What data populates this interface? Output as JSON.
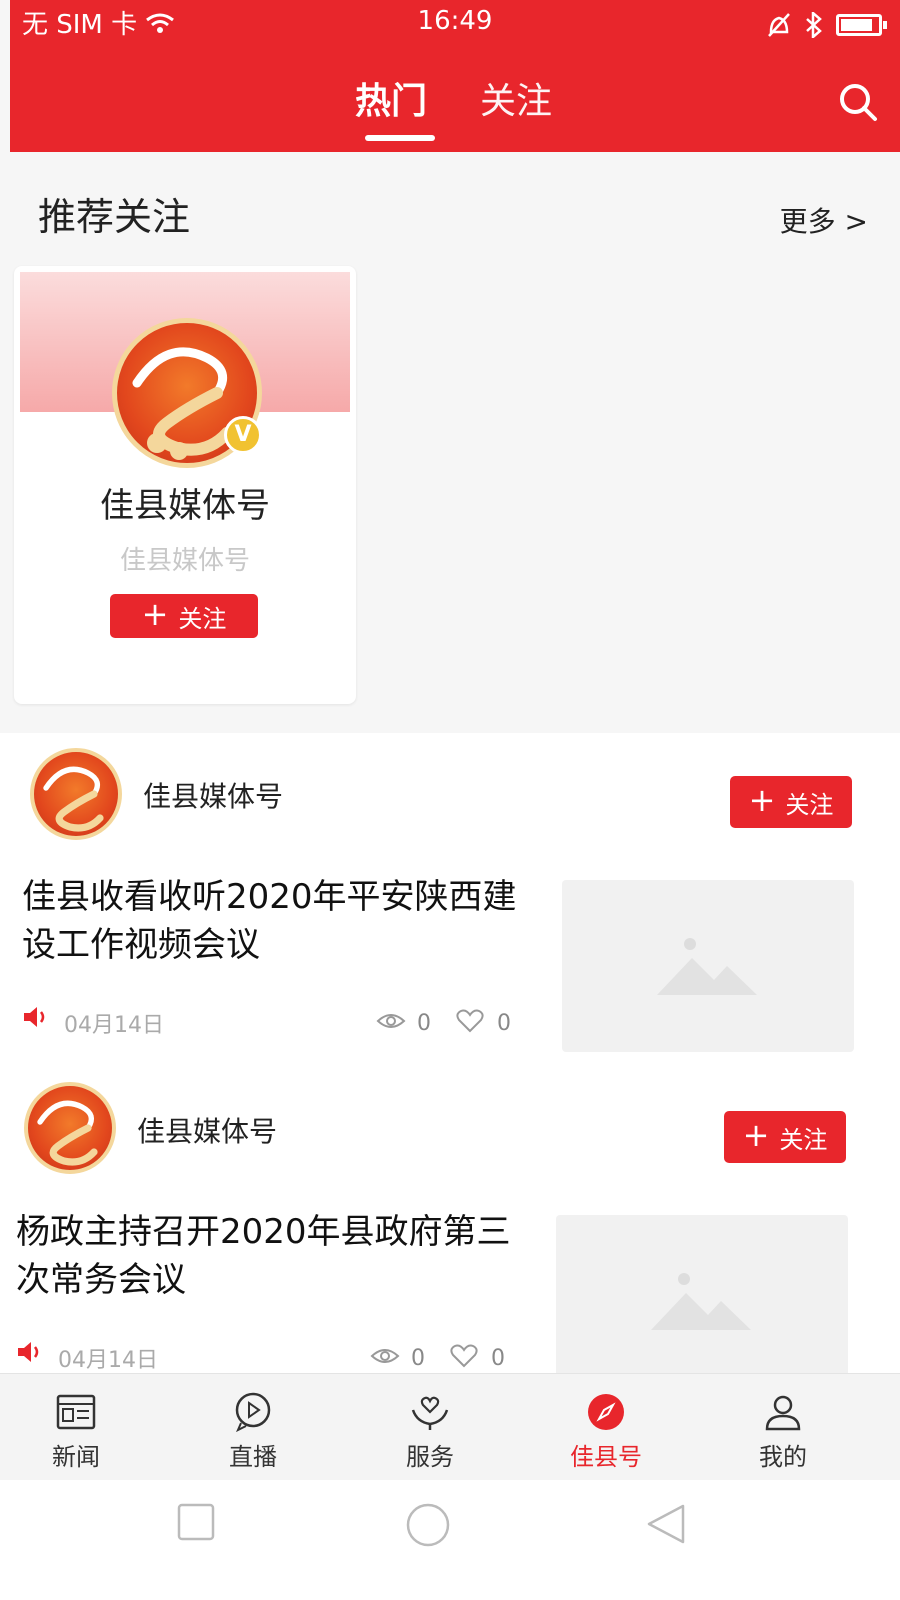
{
  "status_bar": {
    "carrier": "无 SIM 卡",
    "time": "16:49",
    "battery_level": 0.85
  },
  "header": {
    "tabs": [
      {
        "label": "热门",
        "active": true
      },
      {
        "label": "关注",
        "active": false
      }
    ],
    "search_icon": "search-icon",
    "accent_color": "#e8262c"
  },
  "recommend": {
    "title": "推荐关注",
    "more": "更多 >",
    "card": {
      "name": "佳县媒体号",
      "subtitle": "佳县媒体号",
      "verified_badge": "V",
      "follow_label": "关注"
    }
  },
  "feed": [
    {
      "author": "佳县媒体号",
      "follow_label": "关注",
      "title": "佳县收看收听2020年平安陕西建设工作视频会议",
      "date": "04月14日",
      "views": "0",
      "likes": "0"
    },
    {
      "author": "佳县媒体号",
      "follow_label": "关注",
      "title": "杨政主持召开2020年县政府第三次常务会议",
      "date": "04月14日",
      "views": "0",
      "likes": "0"
    }
  ],
  "bottom_nav": [
    {
      "label": "新闻",
      "icon": "news-icon",
      "active": false
    },
    {
      "label": "直播",
      "icon": "live-icon",
      "active": false
    },
    {
      "label": "服务",
      "icon": "service-icon",
      "active": false
    },
    {
      "label": "佳县号",
      "icon": "compass-icon",
      "active": true
    },
    {
      "label": "我的",
      "icon": "profile-icon",
      "active": false
    }
  ],
  "system_nav": [
    "recent-apps",
    "home",
    "back"
  ]
}
